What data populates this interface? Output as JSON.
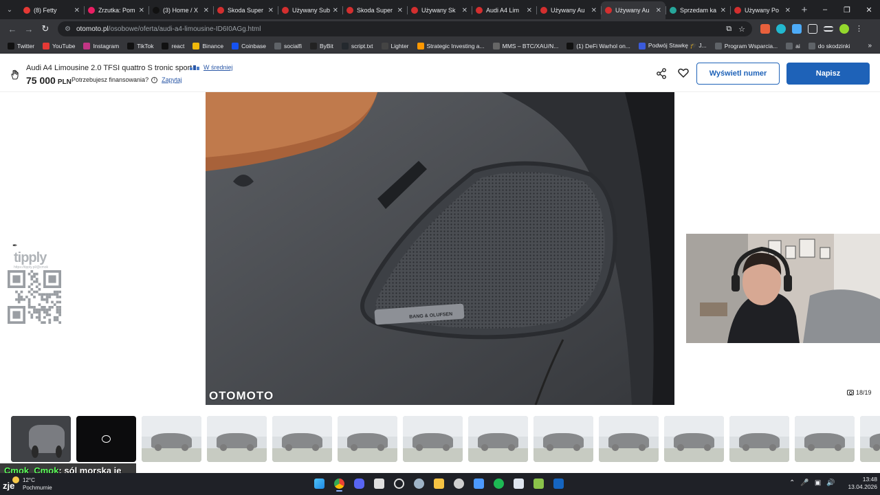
{
  "browser": {
    "tabs": [
      {
        "label": "(8) Fetty",
        "fav_color": "#e53935",
        "active": false
      },
      {
        "label": "Zrzutka: Pom",
        "fav_color": "#e91e63",
        "active": false
      },
      {
        "label": "(3) Home / X",
        "fav_color": "#111111",
        "active": false
      },
      {
        "label": "Skoda Super",
        "fav_color": "#d32f2f",
        "active": false
      },
      {
        "label": "Używany Sub",
        "fav_color": "#d32f2f",
        "active": false
      },
      {
        "label": "Skoda Super",
        "fav_color": "#d32f2f",
        "active": false
      },
      {
        "label": "Używany Sk",
        "fav_color": "#d32f2f",
        "active": false
      },
      {
        "label": "Audi A4 Lim",
        "fav_color": "#d32f2f",
        "active": false
      },
      {
        "label": "Używany Au",
        "fav_color": "#d32f2f",
        "active": false
      },
      {
        "label": "Używany Au",
        "fav_color": "#d32f2f",
        "active": true
      },
      {
        "label": "Sprzedam ka",
        "fav_color": "#26a69a",
        "active": false
      },
      {
        "label": "Używany Po",
        "fav_color": "#d32f2f",
        "active": false
      }
    ],
    "url_host": "otomoto.pl",
    "url_path": "/osobowe/oferta/audi-a4-limousine-ID6I0AGg.html",
    "bookmarks": [
      {
        "label": "Twitter",
        "color": "#111111"
      },
      {
        "label": "YouTube",
        "color": "#e53935"
      },
      {
        "label": "Instagram",
        "color": "#c13584"
      },
      {
        "label": "TikTok",
        "color": "#111111"
      },
      {
        "label": "react",
        "color": "#111111"
      },
      {
        "label": "Binance",
        "color": "#f0b90b"
      },
      {
        "label": "Coinbase",
        "color": "#1652f0"
      },
      {
        "label": "socialfi",
        "color": "#5f6368"
      },
      {
        "label": "ByBit",
        "color": "#222222"
      },
      {
        "label": "script.txt",
        "color": "#24292e"
      },
      {
        "label": "Lighter",
        "color": "#444444"
      },
      {
        "label": "Strategic Investing a...",
        "color": "#ff9800"
      },
      {
        "label": "MMS – BTC/XAU/N...",
        "color": "#666666"
      },
      {
        "label": "(1) DeFi Warhol on...",
        "color": "#111111"
      },
      {
        "label": "Podwój Stawkę 🎓 J...",
        "color": "#3b5bdb"
      },
      {
        "label": "Program Wsparcia...",
        "color": "#5f6368"
      },
      {
        "label": "ai",
        "color": "#5f6368"
      },
      {
        "label": "do skodzinki",
        "color": "#5f6368"
      }
    ]
  },
  "listing": {
    "title": "Audi A4 Limousine 2.0 TFSI quattro S tronic sport",
    "price_badge": "W średniej",
    "price": "75 000",
    "currency": "PLN",
    "financing_question": "Potrzebujesz finansowania?",
    "financing_link": "Zapytaj",
    "show_number_label": "Wyświetl numer",
    "write_label": "Napisz"
  },
  "gallery": {
    "logo": "OTOMOTO",
    "counter": "18/19",
    "speaker_brand": "BANG & OLUFSEN",
    "thumbnails": [
      "interior",
      "video",
      "car",
      "car",
      "car",
      "car",
      "car",
      "car",
      "car",
      "car",
      "car",
      "car",
      "car",
      "car"
    ]
  },
  "overlay": {
    "tipply_logo": "tipply",
    "tipply_url": "https://tipply.pl/@cmok",
    "chat_user": "Cmok_Cmok",
    "chat_message": ": sól morska je"
  },
  "taskbar": {
    "left_text": "zje",
    "temperature": "12°C",
    "condition": "Pochmurnie",
    "time": "13:48",
    "date": "13.04.2026"
  }
}
